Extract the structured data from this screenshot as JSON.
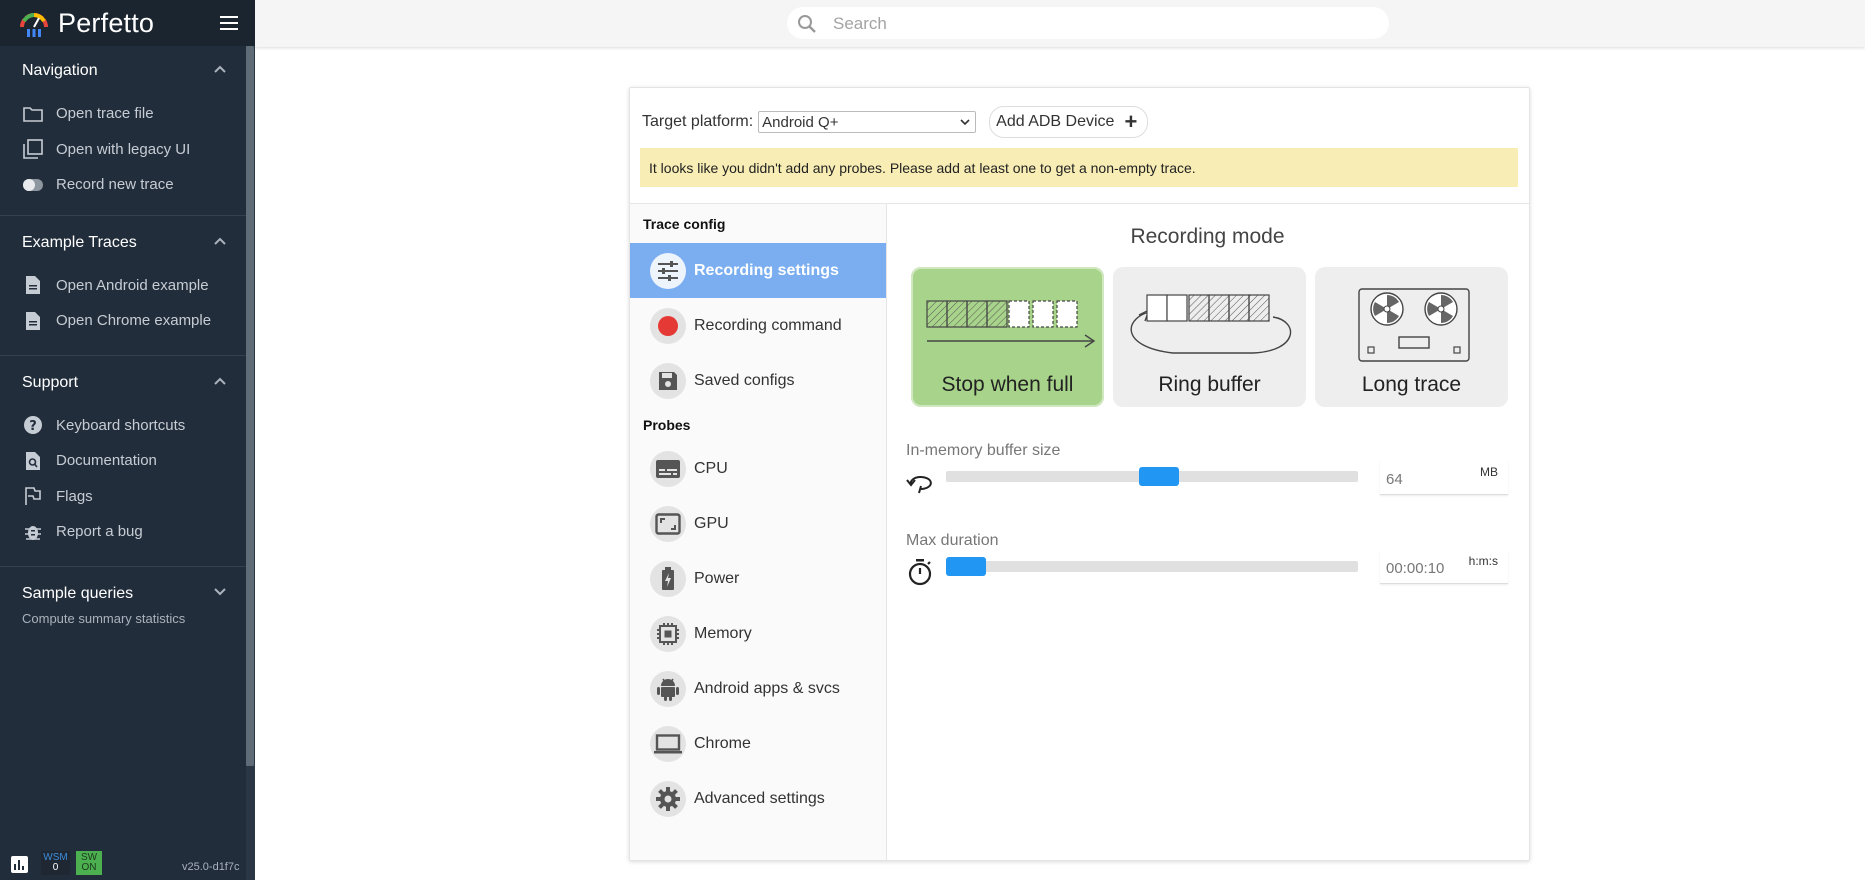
{
  "app": {
    "brand": "Perfetto",
    "version": "v25.0-d1f7c"
  },
  "search": {
    "placeholder": "Search"
  },
  "sidebar": {
    "navigation": {
      "title": "Navigation",
      "items": [
        {
          "label": "Open trace file",
          "icon": "folder-icon"
        },
        {
          "label": "Open with legacy UI",
          "icon": "filter-none-icon"
        },
        {
          "label": "Record new trace",
          "icon": "toggle-icon"
        }
      ]
    },
    "examples": {
      "title": "Example Traces",
      "items": [
        {
          "label": "Open Android example",
          "icon": "description-icon"
        },
        {
          "label": "Open Chrome example",
          "icon": "description-icon"
        }
      ]
    },
    "support": {
      "title": "Support",
      "items": [
        {
          "label": "Keyboard shortcuts",
          "icon": "help-icon"
        },
        {
          "label": "Documentation",
          "icon": "find-in-page-icon"
        },
        {
          "label": "Flags",
          "icon": "emoji-flags-icon"
        },
        {
          "label": "Report a bug",
          "icon": "bug-report-icon"
        }
      ]
    },
    "sample_queries": {
      "title": "Sample queries",
      "subtitle": "Compute summary statistics"
    },
    "footer": {
      "wsm_label": "WSM",
      "wsm_value": "0",
      "sw_label": "SW",
      "sw_value": "ON"
    }
  },
  "record": {
    "platform_label": "Target platform:",
    "platform_value": "Android Q+",
    "add_adb_label": "Add ADB Device",
    "warning": "It looks like you didn't add any probes. Please add at least one to get a non-empty trace.",
    "trace_config_header": "Trace config",
    "config_items": [
      {
        "label": "Recording settings",
        "icon": "tune-icon",
        "active": true
      },
      {
        "label": "Recording command",
        "icon": "record-dot-icon",
        "active": false
      },
      {
        "label": "Saved configs",
        "icon": "save-icon",
        "active": false
      }
    ],
    "probes_header": "Probes",
    "probes": [
      {
        "label": "CPU",
        "icon": "subtitles-icon"
      },
      {
        "label": "GPU",
        "icon": "aspect-ratio-icon"
      },
      {
        "label": "Power",
        "icon": "battery-charging-icon"
      },
      {
        "label": "Memory",
        "icon": "memory-chip-icon"
      },
      {
        "label": "Android apps & svcs",
        "icon": "android-icon"
      },
      {
        "label": "Chrome",
        "icon": "laptop-icon"
      },
      {
        "label": "Advanced settings",
        "icon": "settings-icon"
      }
    ],
    "recording_mode_title": "Recording mode",
    "modes": [
      {
        "label": "Stop when full",
        "selected": true
      },
      {
        "label": "Ring buffer",
        "selected": false
      },
      {
        "label": "Long trace",
        "selected": false
      }
    ],
    "buffer": {
      "label": "In-memory buffer size",
      "value": "64",
      "unit": "MB",
      "slider_fraction": 0.52
    },
    "duration": {
      "label": "Max duration",
      "value": "00:00:10",
      "unit": "h:m:s",
      "slider_fraction": 0.0
    },
    "colors": {
      "accent": "#2196f3",
      "active_item": "#7aaef0",
      "selected_mode": "#a8d38a",
      "warning_bg": "#f8eeb5",
      "sidebar_bg": "#222d3b"
    }
  }
}
